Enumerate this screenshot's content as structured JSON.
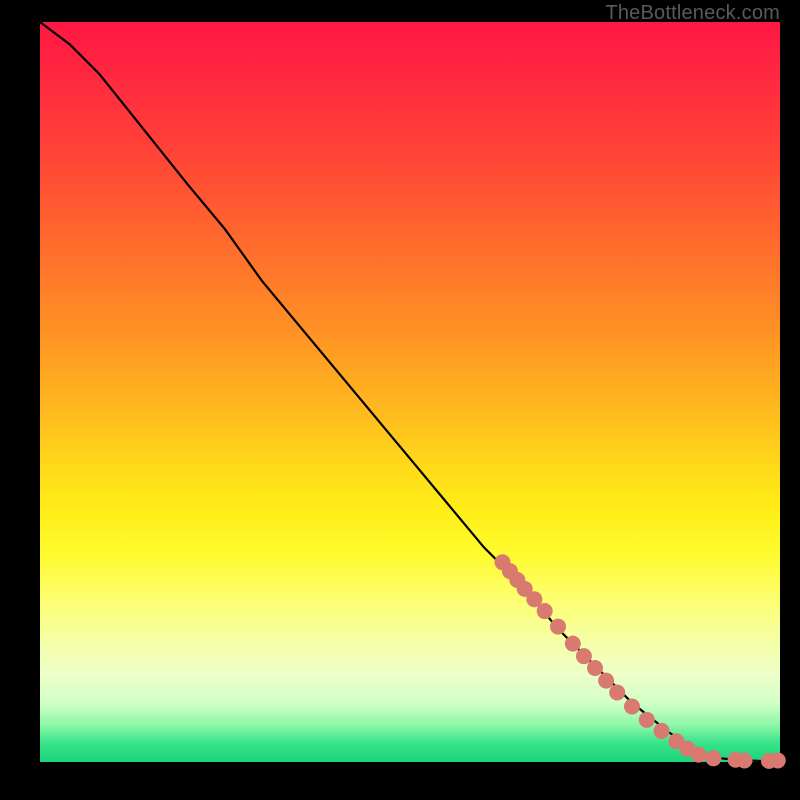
{
  "watermark": "TheBottleneck.com",
  "chart_data": {
    "type": "line",
    "title": "",
    "xlabel": "",
    "ylabel": "",
    "xlim": [
      0,
      100
    ],
    "ylim": [
      0,
      100
    ],
    "grid": false,
    "series": [
      {
        "name": "curve",
        "color": "#000000",
        "x": [
          0,
          4,
          8,
          12,
          16,
          20,
          25,
          30,
          35,
          40,
          45,
          50,
          55,
          60,
          65,
          70,
          75,
          80,
          85,
          88,
          90,
          92,
          94,
          96,
          98,
          100
        ],
        "y": [
          100,
          97,
          93,
          88,
          83,
          78,
          72,
          65,
          59,
          53,
          47,
          41,
          35,
          29,
          24,
          18,
          13,
          8,
          4,
          2,
          1,
          0.5,
          0.3,
          0.2,
          0.1,
          0.1
        ]
      }
    ],
    "markers": [
      {
        "x": 62.5,
        "y": 27.0
      },
      {
        "x": 63.5,
        "y": 25.8
      },
      {
        "x": 64.5,
        "y": 24.6
      },
      {
        "x": 65.5,
        "y": 23.4
      },
      {
        "x": 66.8,
        "y": 22.0
      },
      {
        "x": 68.2,
        "y": 20.4
      },
      {
        "x": 70.0,
        "y": 18.3
      },
      {
        "x": 72.0,
        "y": 16.0
      },
      {
        "x": 73.5,
        "y": 14.3
      },
      {
        "x": 75.0,
        "y": 12.7
      },
      {
        "x": 76.5,
        "y": 11.0
      },
      {
        "x": 78.0,
        "y": 9.4
      },
      {
        "x": 80.0,
        "y": 7.5
      },
      {
        "x": 82.0,
        "y": 5.7
      },
      {
        "x": 84.0,
        "y": 4.2
      },
      {
        "x": 86.0,
        "y": 2.8
      },
      {
        "x": 87.5,
        "y": 1.8
      },
      {
        "x": 89.0,
        "y": 1.0
      },
      {
        "x": 91.0,
        "y": 0.5
      },
      {
        "x": 94.0,
        "y": 0.3
      },
      {
        "x": 95.2,
        "y": 0.2
      },
      {
        "x": 98.5,
        "y": 0.15
      },
      {
        "x": 99.7,
        "y": 0.2
      }
    ],
    "marker_style": {
      "color": "#d87a70",
      "radius_px": 8
    }
  }
}
